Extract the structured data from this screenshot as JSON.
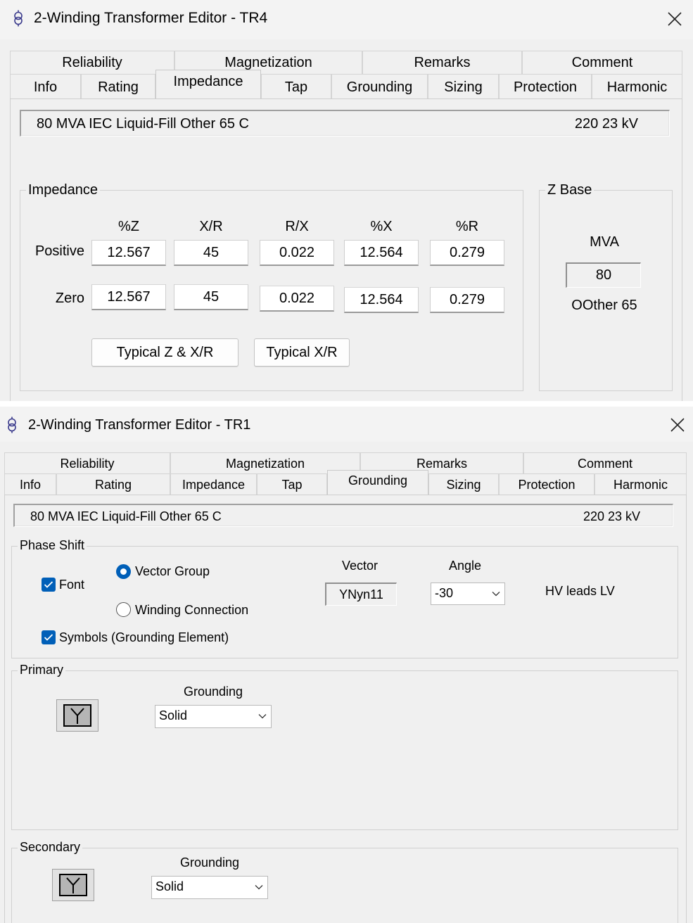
{
  "window1": {
    "title": "2-Winding Transformer Editor - TR4",
    "tabs_top": [
      "Reliability",
      "Magnetization",
      "Remarks",
      "Comment"
    ],
    "tabs_bottom": [
      "Info",
      "Rating",
      "Impedance",
      "Tap",
      "Grounding",
      "Sizing",
      "Protection",
      "Harmonic"
    ],
    "active_tab": "Impedance",
    "info_desc": "80 MVA  IEC  Liquid-Fill  Other  65 C",
    "info_kv": "220    23 kV",
    "impedance": {
      "group_title": "Impedance",
      "columns": [
        "%Z",
        "X/R",
        "R/X",
        "%X",
        "%R"
      ],
      "rows": [
        {
          "label": "Positive",
          "values": [
            "12.567",
            "45",
            "0.022",
            "12.564",
            "0.279"
          ]
        },
        {
          "label": "Zero",
          "values": [
            "12.567",
            "45",
            "0.022",
            "12.564",
            "0.279"
          ]
        }
      ],
      "buttons": {
        "typical_z_xr": "Typical Z & X/R",
        "typical_xr": "Typical X/R"
      }
    },
    "zbase": {
      "group_title": "Z Base",
      "mva_label": "MVA",
      "mva_value": "80",
      "note": "OOther 65"
    }
  },
  "window2": {
    "title": "2-Winding Transformer Editor - TR1",
    "tabs_top": [
      "Reliability",
      "Magnetization",
      "Remarks",
      "Comment"
    ],
    "tabs_bottom": [
      "Info",
      "Rating",
      "Impedance",
      "Tap",
      "Grounding",
      "Sizing",
      "Protection",
      "Harmonic"
    ],
    "active_tab": "Grounding",
    "info_desc": "80 MVA  IEC  Liquid-Fill  Other  65 C",
    "info_kv": "220    23 kV",
    "phase_shift": {
      "group_title": "Phase Shift",
      "font_checkbox": {
        "label": "Font",
        "checked": true
      },
      "vector_group_radio": {
        "label": "Vector Group",
        "selected": true
      },
      "winding_connection_radio": {
        "label": "Winding Connection",
        "selected": false
      },
      "symbols_checkbox": {
        "label": "Symbols (Grounding Element)",
        "checked": true
      },
      "vector_label": "Vector",
      "vector_value": "YNyn11",
      "angle_label": "Angle",
      "angle_value": "-30",
      "lead_text": "HV leads LV"
    },
    "primary": {
      "group_title": "Primary",
      "grounding_label": "Grounding",
      "grounding_value": "Solid",
      "symbol": "Y"
    },
    "secondary": {
      "group_title": "Secondary",
      "grounding_label": "Grounding",
      "grounding_value": "Solid",
      "symbol": "Y"
    }
  },
  "icons": {
    "app": "transformer-icon",
    "close": "close-icon",
    "checkmark": "checkmark-icon",
    "dropdown": "chevron-down-icon"
  },
  "colors": {
    "accent": "#005fb8",
    "background": "#f0f0f0",
    "titlebar": "#f3f3f3"
  }
}
